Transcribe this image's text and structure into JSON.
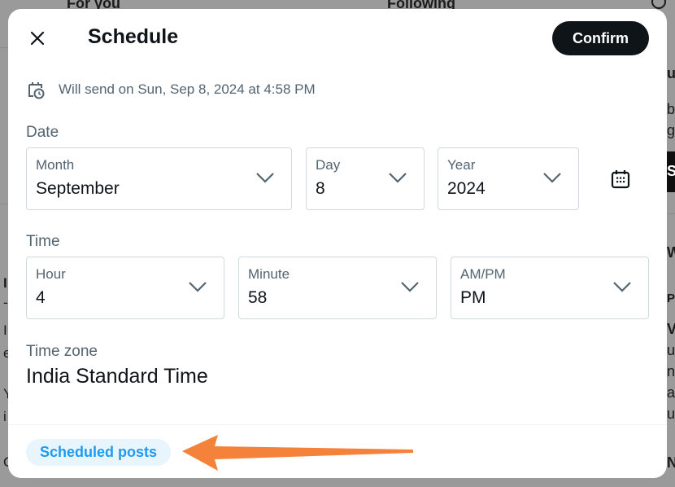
{
  "background": {
    "tabs": [
      "For you",
      "Following"
    ],
    "right_fragments": [
      "ul",
      "b",
      "gi",
      "S",
      "W",
      "P",
      "VE",
      "ur",
      "nt",
      "ah",
      "u",
      "N"
    ],
    "left_fragments": [
      "I",
      "-",
      "I",
      "e",
      "Y",
      "i",
      "C"
    ]
  },
  "modal": {
    "title": "Schedule",
    "confirm_label": "Confirm",
    "send_info": "Will send on Sun, Sep 8, 2024 at 4:58 PM",
    "date": {
      "section_label": "Date",
      "month": {
        "label": "Month",
        "value": "September"
      },
      "day": {
        "label": "Day",
        "value": "8"
      },
      "year": {
        "label": "Year",
        "value": "2024"
      }
    },
    "time": {
      "section_label": "Time",
      "hour": {
        "label": "Hour",
        "value": "4"
      },
      "minute": {
        "label": "Minute",
        "value": "58"
      },
      "ampm": {
        "label": "AM/PM",
        "value": "PM"
      }
    },
    "timezone": {
      "label": "Time zone",
      "value": "India Standard Time"
    },
    "scheduled_posts_label": "Scheduled posts"
  },
  "icons": {
    "close": "close-icon",
    "send_info": "calendar-clock-icon",
    "calendar_picker": "calendar-icon",
    "chevron": "chevron-down-icon",
    "annotation": "arrow-left-annotation"
  },
  "colors": {
    "accent": "#1d9bf0",
    "primary_button": "#0f1419",
    "annotation_arrow": "#f5823a"
  }
}
